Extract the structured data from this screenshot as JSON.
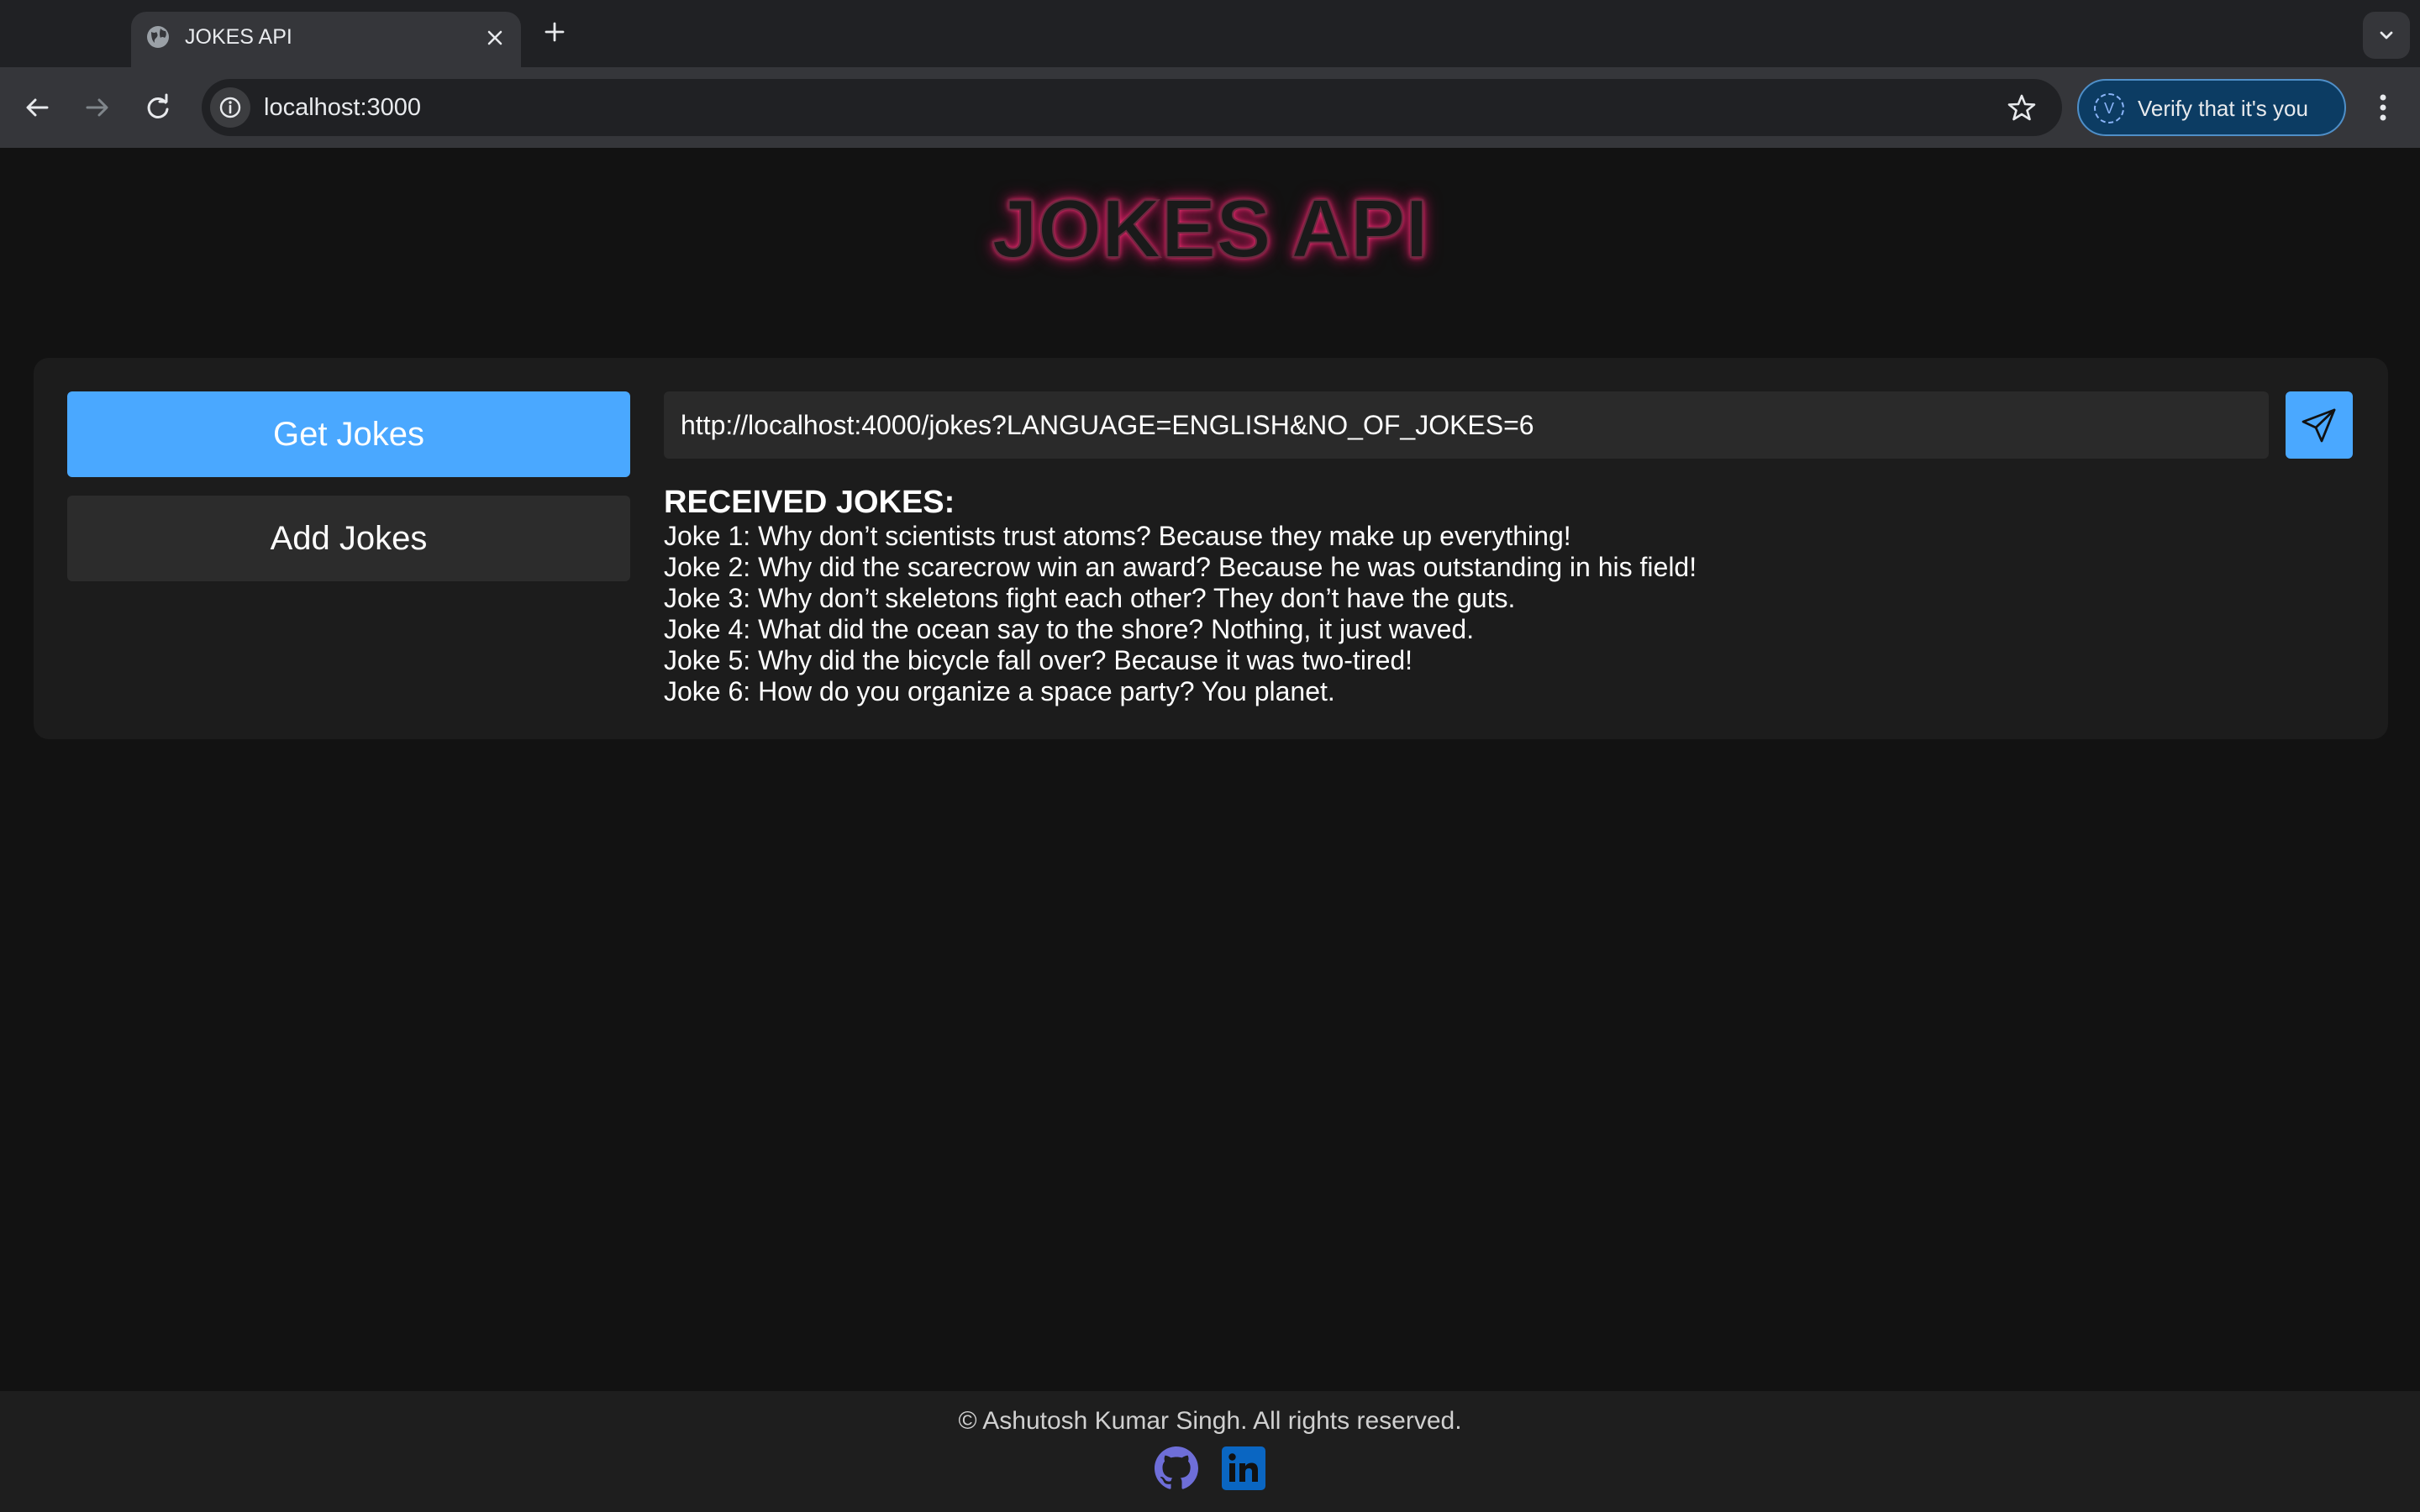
{
  "browser": {
    "tab_title": "JOKES API",
    "url": "localhost:3000",
    "verify_label": "Verify that it's you",
    "verify_avatar": "V"
  },
  "page": {
    "title": "JOKES API",
    "get_jokes_label": "Get Jokes",
    "add_jokes_label": "Add Jokes",
    "request_url": "http://localhost:4000/jokes?LANGUAGE=ENGLISH&NO_OF_JOKES=6",
    "received_heading": "RECEIVED JOKES:",
    "jokes": [
      "Joke 1: Why don’t scientists trust atoms? Because they make up everything!",
      "Joke 2: Why did the scarecrow win an award? Because he was outstanding in his field!",
      "Joke 3: Why don’t skeletons fight each other? They don’t have the guts.",
      "Joke 4: What did the ocean say to the shore? Nothing, it just waved.",
      "Joke 5: Why did the bicycle fall over? Because it was two-tired!",
      "Joke 6: How do you organize a space party? You planet."
    ]
  },
  "footer": {
    "copyright": "© Ashutosh Kumar Singh. All rights reserved."
  },
  "colors": {
    "accent_blue": "#4aa8ff",
    "title_glow": "#ff3b7a",
    "linkedin_blue": "#0a66c2",
    "github_purple": "#6e6ed8"
  }
}
